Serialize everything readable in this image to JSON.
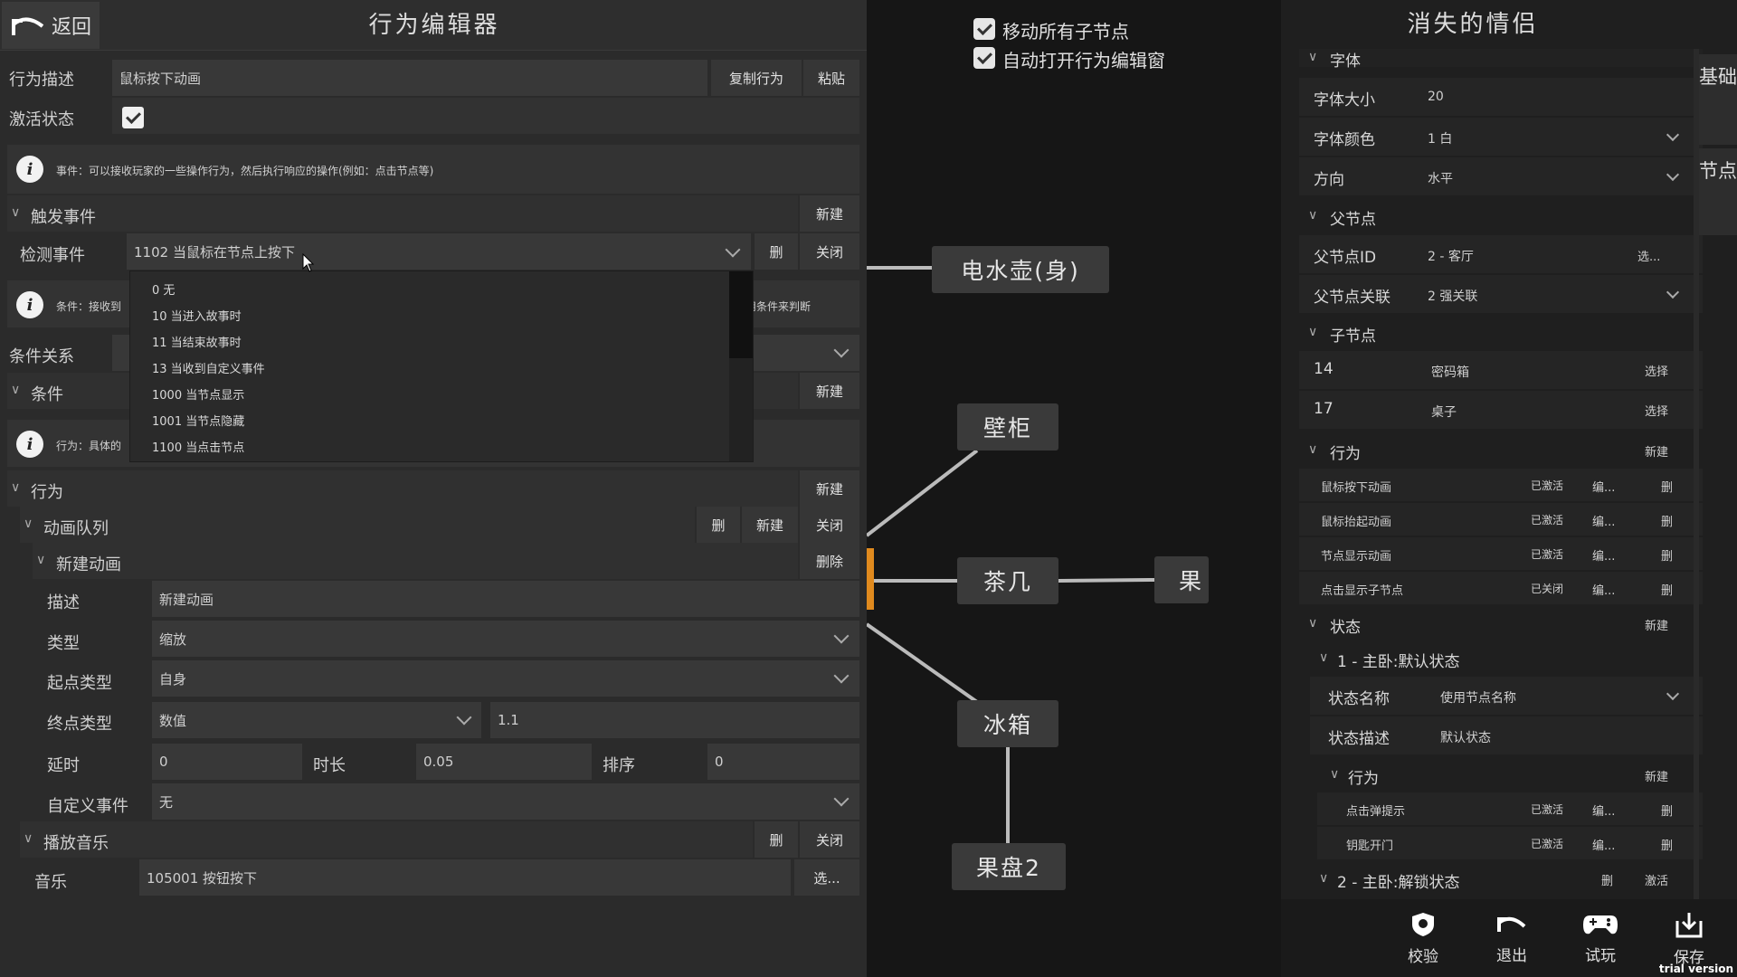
{
  "editor": {
    "back_label": "返回",
    "title": "行为编辑器",
    "desc_label": "行为描述",
    "desc_value": "鼠标按下动画",
    "copy_btn": "复制行为",
    "paste_btn": "粘贴",
    "active_label": "激活状态",
    "event_info": "事件：可以接收玩家的一些操作行为，然后执行响应的操作(例如：点击节点等)",
    "trigger_section": "触发事件",
    "new_btn": "新建",
    "detect_label": "检测事件",
    "detect_value": "1102 当鼠标在节点上按下",
    "del_btn": "删",
    "close_btn": "关闭",
    "cond_info": "条件：接收到",
    "cond_info_right": "使用条件来判断",
    "cond_rel_label": "条件关系",
    "cond_section": "条件",
    "act_info": "行为：具体的",
    "behavior_section": "行为",
    "anim_queue": "动画队列",
    "new_anim": "新建动画",
    "delete_btn": "删除",
    "desc2_label": "描述",
    "desc2_value": "新建动画",
    "type_label": "类型",
    "type_value": "缩放",
    "start_type_label": "起点类型",
    "start_type_value": "自身",
    "end_type_label": "终点类型",
    "end_type_value": "数值",
    "end_value": "1.1",
    "delay_label": "延时",
    "delay_value": "0",
    "duration_label": "时长",
    "duration_value": "0.05",
    "order_label": "排序",
    "order_value": "0",
    "custom_event_label": "自定义事件",
    "custom_event_value": "无",
    "music_section": "播放音乐",
    "music_label": "音乐",
    "music_value": "105001 按钮按下",
    "select_btn": "选..."
  },
  "dropdown": {
    "items": [
      "0 无",
      "10 当进入故事时",
      "11 当结束故事时",
      "13 当收到自定义事件",
      "1000 当节点显示",
      "1001 当节点隐藏",
      "1100 当点击节点"
    ]
  },
  "graph": {
    "move_children": "移动所有子节点",
    "auto_open": "自动打开行为编辑窗",
    "nodes": [
      "电水壶(身)",
      "壁柜",
      "茶几",
      "果",
      "冰箱",
      "果盘2"
    ]
  },
  "inspector": {
    "title": "消失的情侣",
    "tab_basic": "基础",
    "tab_node": "节点",
    "font_section": "字体",
    "font_size_label": "字体大小",
    "font_size_value": "20",
    "font_color_label": "字体颜色",
    "font_color_value": "1 白",
    "direction_label": "方向",
    "direction_value": "水平",
    "parent_section": "父节点",
    "parent_id_label": "父节点ID",
    "parent_id_value": "2 - 客厅",
    "select_short": "选...",
    "parent_rel_label": "父节点关联",
    "parent_rel_value": "2 强关联",
    "child_section": "子节点",
    "children": [
      {
        "id": "14",
        "name": "密码箱",
        "action": "选择"
      },
      {
        "id": "17",
        "name": "桌子",
        "action": "选择"
      }
    ],
    "behavior_section": "行为",
    "new_btn": "新建",
    "behaviors": [
      {
        "name": "鼠标按下动画",
        "state": "已激活",
        "edit": "编...",
        "del": "删"
      },
      {
        "name": "鼠标抬起动画",
        "state": "已激活",
        "edit": "编...",
        "del": "删"
      },
      {
        "name": "节点显示动画",
        "state": "已激活",
        "edit": "编...",
        "del": "删"
      },
      {
        "name": "点击显示子节点",
        "state": "已关闭",
        "edit": "编...",
        "del": "删"
      }
    ],
    "state_section": "状态",
    "state1": "1 - 主卧:默认状态",
    "state_name_label": "状态名称",
    "state_name_value": "使用节点名称",
    "state_desc_label": "状态描述",
    "state_desc_value": "默认状态",
    "sub_behavior_section": "行为",
    "sub_behaviors": [
      {
        "name": "点击弹提示",
        "state": "已激活",
        "edit": "编...",
        "del": "删"
      },
      {
        "name": "钥匙开门",
        "state": "已激活",
        "edit": "编...",
        "del": "删"
      }
    ],
    "state2": "2 - 主卧:解锁状态",
    "state2_del": "删",
    "state2_activate": "激活"
  },
  "toolbar": {
    "verify": "校验",
    "exit": "退出",
    "test": "试玩",
    "save": "保存",
    "trial": "trial version"
  }
}
